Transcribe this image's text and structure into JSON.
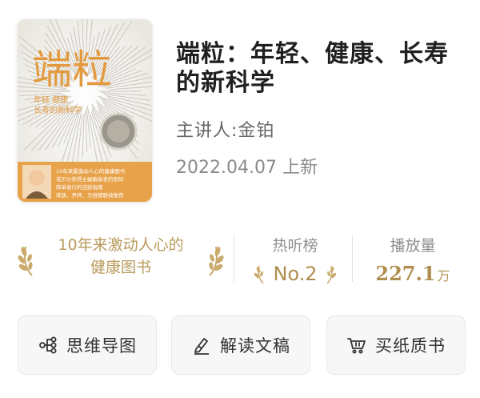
{
  "book": {
    "cover_title": "端粒",
    "cover_subtitle_1": "年轻 健康",
    "cover_subtitle_2": "长寿的新科学",
    "cover_blurb": [
      "10年来最激动人心的健康图书",
      "诺贝尔奖得主破解衰老的密码",
      "简单易行的逆龄指南",
      "荣获、尹烨、万维钢联袂推荐"
    ],
    "title": "端粒：年轻、健康、长寿的新科学",
    "speaker": "主讲人:金铂",
    "date": "2022.04.07 上新"
  },
  "stats": {
    "award_line1": "10年来激动人心的",
    "award_line2": "健康图书",
    "rank_label": "热听榜",
    "rank_value": "No.2",
    "views_label": "播放量",
    "views_value": "227.1",
    "views_unit": "万"
  },
  "actions": {
    "mindmap": "思维导图",
    "transcript": "解读文稿",
    "buy_book": "买纸质书"
  },
  "colors": {
    "gold": "#b89a5b",
    "cover_orange": "#e8a24a"
  }
}
